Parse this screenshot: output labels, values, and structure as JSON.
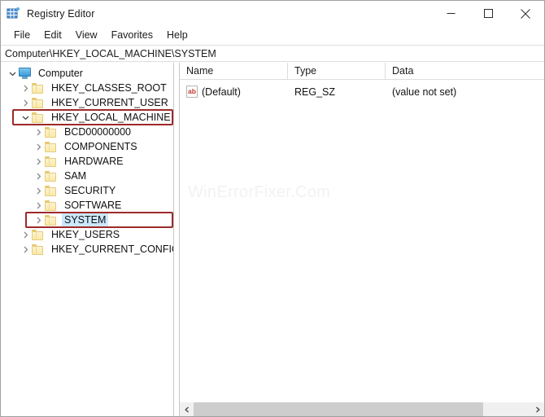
{
  "window": {
    "title": "Registry Editor",
    "icon": "registry-editor-icon",
    "controls": {
      "minimize": "minimize-icon",
      "maximize": "maximize-icon",
      "close": "close-icon"
    }
  },
  "menubar": {
    "items": [
      {
        "label": "File"
      },
      {
        "label": "Edit"
      },
      {
        "label": "View"
      },
      {
        "label": "Favorites"
      },
      {
        "label": "Help"
      }
    ]
  },
  "address": {
    "path": "Computer\\HKEY_LOCAL_MACHINE\\SYSTEM"
  },
  "tree": {
    "nodes": [
      {
        "label": "Computer",
        "icon": "computer-icon",
        "depth": 0,
        "expanded": true,
        "selected": false,
        "highlighted": false
      },
      {
        "label": "HKEY_CLASSES_ROOT",
        "icon": "folder-icon",
        "depth": 1,
        "expanded": false,
        "selected": false,
        "highlighted": false
      },
      {
        "label": "HKEY_CURRENT_USER",
        "icon": "folder-icon",
        "depth": 1,
        "expanded": false,
        "selected": false,
        "highlighted": false
      },
      {
        "label": "HKEY_LOCAL_MACHINE",
        "icon": "folder-icon",
        "depth": 1,
        "expanded": true,
        "selected": false,
        "highlighted": true
      },
      {
        "label": "BCD00000000",
        "icon": "folder-icon",
        "depth": 2,
        "expanded": false,
        "selected": false,
        "highlighted": false
      },
      {
        "label": "COMPONENTS",
        "icon": "folder-icon",
        "depth": 2,
        "expanded": false,
        "selected": false,
        "highlighted": false
      },
      {
        "label": "HARDWARE",
        "icon": "folder-icon",
        "depth": 2,
        "expanded": false,
        "selected": false,
        "highlighted": false
      },
      {
        "label": "SAM",
        "icon": "folder-icon",
        "depth": 2,
        "expanded": false,
        "selected": false,
        "highlighted": false
      },
      {
        "label": "SECURITY",
        "icon": "folder-icon",
        "depth": 2,
        "expanded": false,
        "selected": false,
        "highlighted": false
      },
      {
        "label": "SOFTWARE",
        "icon": "folder-icon",
        "depth": 2,
        "expanded": false,
        "selected": false,
        "highlighted": false
      },
      {
        "label": "SYSTEM",
        "icon": "folder-icon",
        "depth": 2,
        "expanded": false,
        "selected": true,
        "highlighted": true
      },
      {
        "label": "HKEY_USERS",
        "icon": "folder-icon",
        "depth": 1,
        "expanded": false,
        "selected": false,
        "highlighted": false
      },
      {
        "label": "HKEY_CURRENT_CONFIG",
        "icon": "folder-icon",
        "depth": 1,
        "expanded": false,
        "selected": false,
        "highlighted": false
      }
    ]
  },
  "list": {
    "columns": [
      {
        "label": "Name"
      },
      {
        "label": "Type"
      },
      {
        "label": "Data"
      }
    ],
    "rows": [
      {
        "icon": "string-value-icon",
        "name": "(Default)",
        "type": "REG_SZ",
        "data": "(value not set)"
      }
    ]
  },
  "watermark": {
    "text": "WinErrorFixer.Com"
  },
  "scrollbar": {
    "left_arrow": "chevron-left-icon",
    "right_arrow": "chevron-right-icon"
  },
  "colors": {
    "highlight_box": "#9e2a2a",
    "selection": "#cce8ff",
    "folder": "#fbe9a8",
    "accent": "#3a9ad9"
  }
}
